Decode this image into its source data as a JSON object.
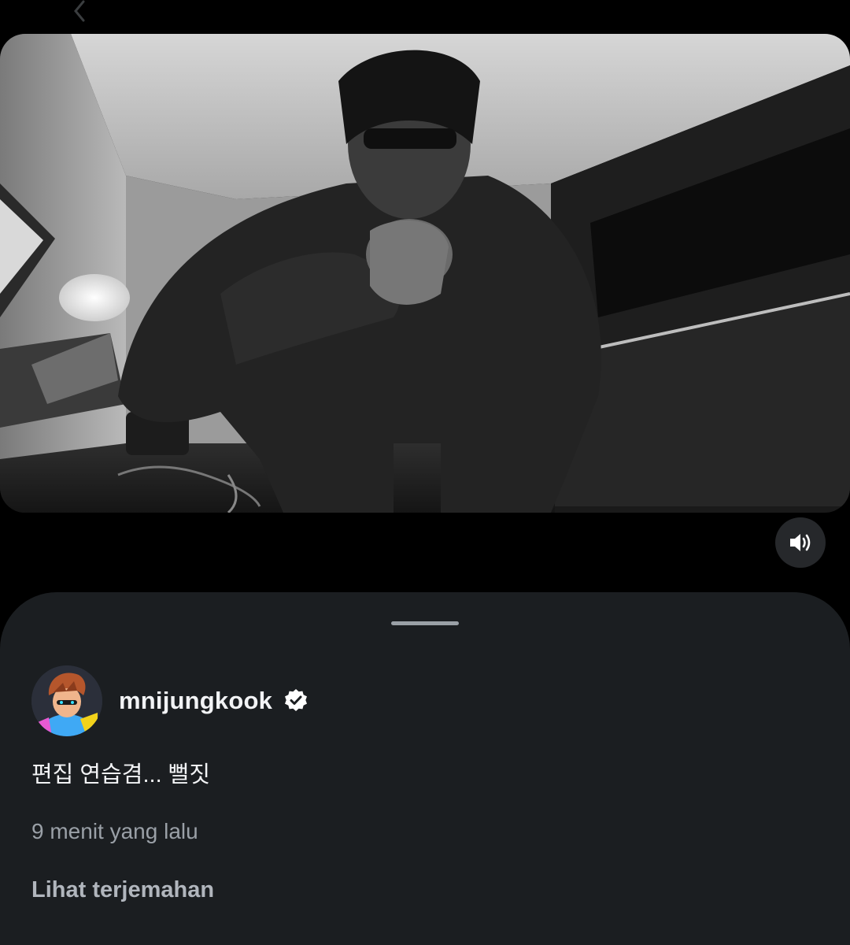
{
  "nav": {
    "back_icon": "chevron-left-icon"
  },
  "media": {
    "type": "video",
    "description_icon": "video-frame",
    "mute_icon": "speaker-volume-icon"
  },
  "post": {
    "username": "mnijungkook",
    "verified": true,
    "caption": "편집 연습겸... 뻘짓",
    "timestamp": "9 menit yang lalu",
    "translate_label": "Lihat terjemahan"
  },
  "colors": {
    "sheet_bg": "#1b1e21",
    "page_bg": "#000000",
    "text_primary": "#f2f3f5",
    "text_secondary": "#9aa0a7"
  }
}
